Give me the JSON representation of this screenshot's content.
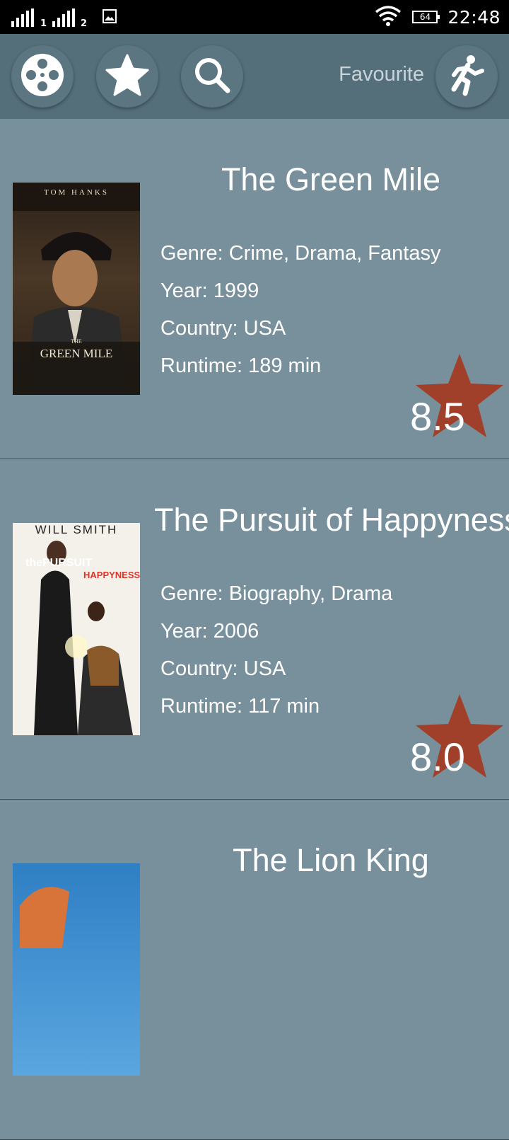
{
  "status_bar": {
    "sim1": "1",
    "sim2": "2",
    "battery": "64",
    "time": "22:48"
  },
  "toolbar": {
    "favourite_label": "Favourite",
    "icons": [
      "film-reel-icon",
      "star-icon",
      "search-icon",
      "running-person-icon"
    ]
  },
  "colors": {
    "background": "#78909c",
    "toolbar": "#546e7a",
    "rating_star": "#a0402a"
  },
  "movies": [
    {
      "title": "The Green Mile",
      "genre": "Genre: Crime, Drama, Fantasy",
      "year": "Year: 1999",
      "country": "Country: USA",
      "runtime": "Runtime: 189 min",
      "rating": "8.5",
      "poster_text": {
        "top": "TOM  HANKS",
        "title": "GREEN MILE",
        "small": "THE"
      }
    },
    {
      "title": "The Pursuit of Happyness",
      "genre": "Genre: Biography, Drama",
      "year": "Year: 2006",
      "country": "Country: USA",
      "runtime": "Runtime: 117 min",
      "rating": "8.0",
      "poster_text": {
        "top": "WILL SMITH",
        "title1": "thePURSUIT",
        "title2": "HAPPYNESS"
      }
    },
    {
      "title": "The Lion King"
    }
  ]
}
